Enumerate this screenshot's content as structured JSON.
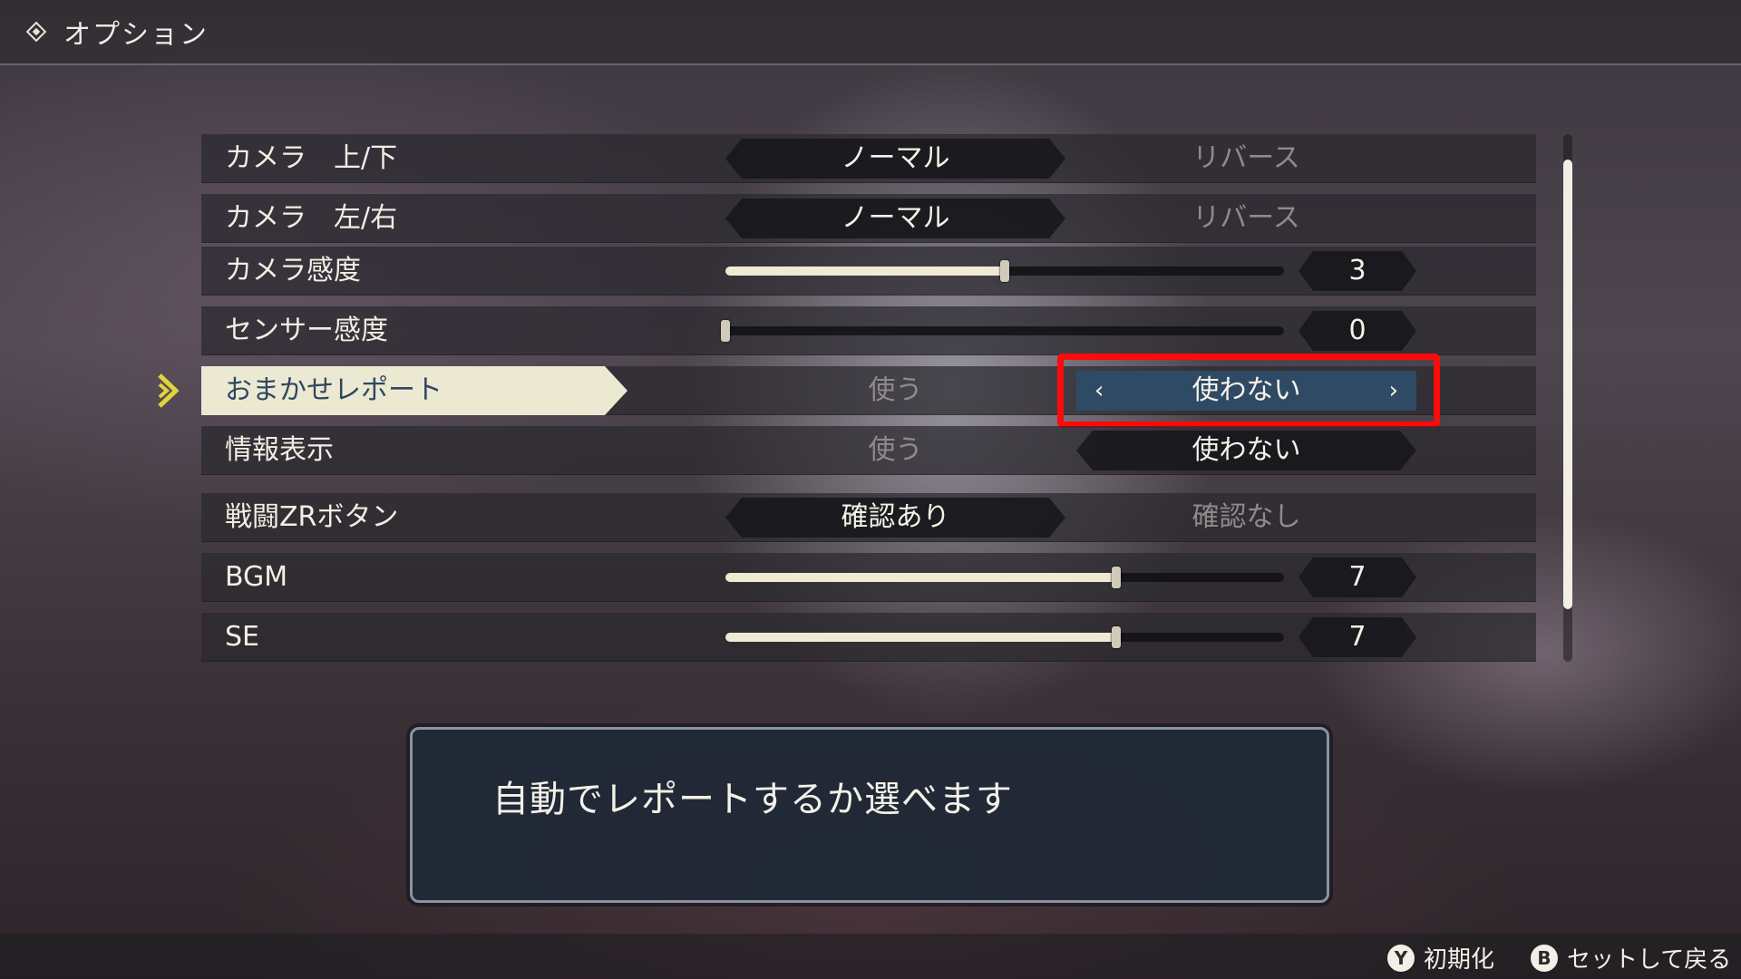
{
  "header": {
    "title": "オプション",
    "icon": "menu-diamond-icon"
  },
  "rows": [
    {
      "label": "カメラ　上/下",
      "type": "toggle",
      "option_a": "ノーマル",
      "option_b": "リバース",
      "selected": "a"
    },
    {
      "label": "カメラ　左/右",
      "type": "toggle",
      "option_a": "ノーマル",
      "option_b": "リバース",
      "selected": "a"
    },
    {
      "label": "カメラ感度",
      "type": "slider",
      "value": "3",
      "fraction": 0.5
    },
    {
      "label": "センサー感度",
      "type": "slider",
      "value": "0",
      "fraction": 0.0
    },
    {
      "label": "おまかせレポート",
      "type": "toggle",
      "option_a": "使う",
      "option_b": "使わない",
      "selected": "b",
      "focused": true
    },
    {
      "label": "情報表示",
      "type": "toggle",
      "option_a": "使う",
      "option_b": "使わない",
      "selected": "b"
    },
    {
      "label": "戦闘ZRボタン",
      "type": "toggle",
      "option_a": "確認あり",
      "option_b": "確認なし",
      "selected": "a"
    },
    {
      "label": "BGM",
      "type": "slider",
      "value": "7",
      "fraction": 0.7
    },
    {
      "label": "SE",
      "type": "slider",
      "value": "7",
      "fraction": 0.7
    }
  ],
  "description": "自動でレポートするか選べます",
  "footer": {
    "reset": {
      "button": "Y",
      "label": "初期化"
    },
    "back": {
      "button": "B",
      "label": "セットして戻る"
    }
  },
  "colors": {
    "highlight": "#ff0a0a",
    "selected_option": "#2f4a64",
    "focus_label": "#ece9d2",
    "cursor": "#e2d33a"
  }
}
